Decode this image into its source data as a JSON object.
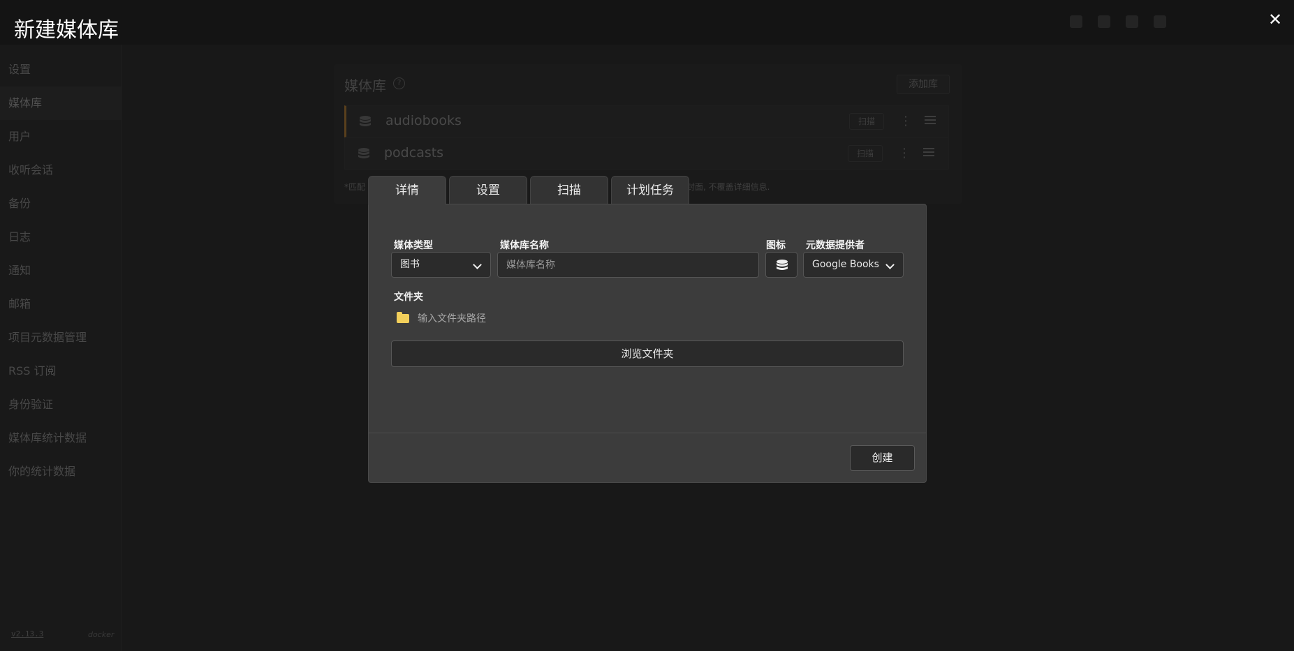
{
  "background": {
    "sidebar": {
      "items": [
        {
          "label": "设置"
        },
        {
          "label": "媒体库"
        },
        {
          "label": "用户"
        },
        {
          "label": "收听会话"
        },
        {
          "label": "备份"
        },
        {
          "label": "日志"
        },
        {
          "label": "通知"
        },
        {
          "label": "邮箱"
        },
        {
          "label": "项目元数据管理"
        },
        {
          "label": "RSS 订阅"
        },
        {
          "label": "身份验证"
        },
        {
          "label": "媒体库统计数据"
        },
        {
          "label": "你的统计数据"
        }
      ],
      "version": "v2.13.3",
      "platform": "docker"
    },
    "libraries_panel": {
      "title": "媒体库",
      "add_button": "添加库",
      "rows": [
        {
          "name": "audiobooks",
          "scan": "扫描"
        },
        {
          "name": "podcasts",
          "scan": "扫描"
        }
      ],
      "note_left": "*匹配",
      "note_right": "封面, 不覆盖详细信息."
    }
  },
  "modal": {
    "title": "新建媒体库",
    "close_icon": "close-icon",
    "tabs": [
      {
        "label": "详情"
      },
      {
        "label": "设置"
      },
      {
        "label": "扫描"
      },
      {
        "label": "计划任务"
      }
    ],
    "fields": {
      "media_type_label": "媒体类型",
      "media_type_value": "图书",
      "library_name_label": "媒体库名称",
      "library_name_placeholder": "媒体库名称",
      "icon_label": "图标",
      "provider_label": "元数据提供者",
      "provider_value": "Google Books",
      "folders_label": "文件夹",
      "folder_path_placeholder": "输入文件夹路径"
    },
    "browse_button": "浏览文件夹",
    "create_button": "创建"
  }
}
